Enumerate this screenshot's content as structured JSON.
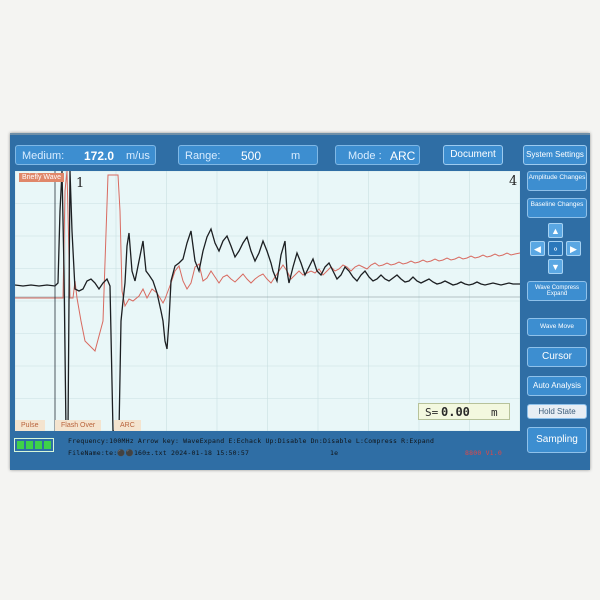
{
  "top_bar": {
    "medium_label": "Medium:",
    "medium_value": "172.0",
    "medium_unit": "m/us",
    "range_label": "Range:",
    "range_value": "500",
    "range_unit": "m",
    "mode_label": "Mode :",
    "mode_value": "ARC",
    "document_button": "Document",
    "system_settings_button": "System Settings"
  },
  "plot": {
    "brief_wave_tag": "Briefly Wave",
    "cursor_1_label": "1",
    "cursor_4_label": "4",
    "mode_tabs": [
      "Pulse",
      "Flash Over",
      "ARC"
    ],
    "distance_prefix": "S=",
    "distance_value": "0.00",
    "distance_unit": "m",
    "trace_colors": {
      "measured": "#1c1f22",
      "reference": "#d86a60"
    }
  },
  "side_panel": {
    "amplitude_changes": "Amplitude Changes",
    "baseline_changes": "Baseline Changes",
    "wave_compress_expand": "Wave Compress Expand",
    "wave_move": "Wave Move",
    "cursor": "Cursor",
    "auto_analysis": "Auto Analysis",
    "hold_state": "Hold State",
    "sampling": "Sampling",
    "arrow_icons": [
      "arrow-up-icon",
      "arrow-left-icon",
      "center-icon",
      "arrow-right-icon",
      "arrow-down-icon"
    ]
  },
  "status_bar": {
    "line1": "Frequency:100MHz Arrow key:  WaveExpand  E:Echack  Up:Disable  Dn:Disable  L:Compress  R:Expand",
    "line2": "FileName:te:⚫⚫160±.txt  2024-01-18 15:50:57",
    "line2_extra": "1e",
    "line2_red": "8800 V1.0",
    "battery_color": "#3ed24a"
  }
}
